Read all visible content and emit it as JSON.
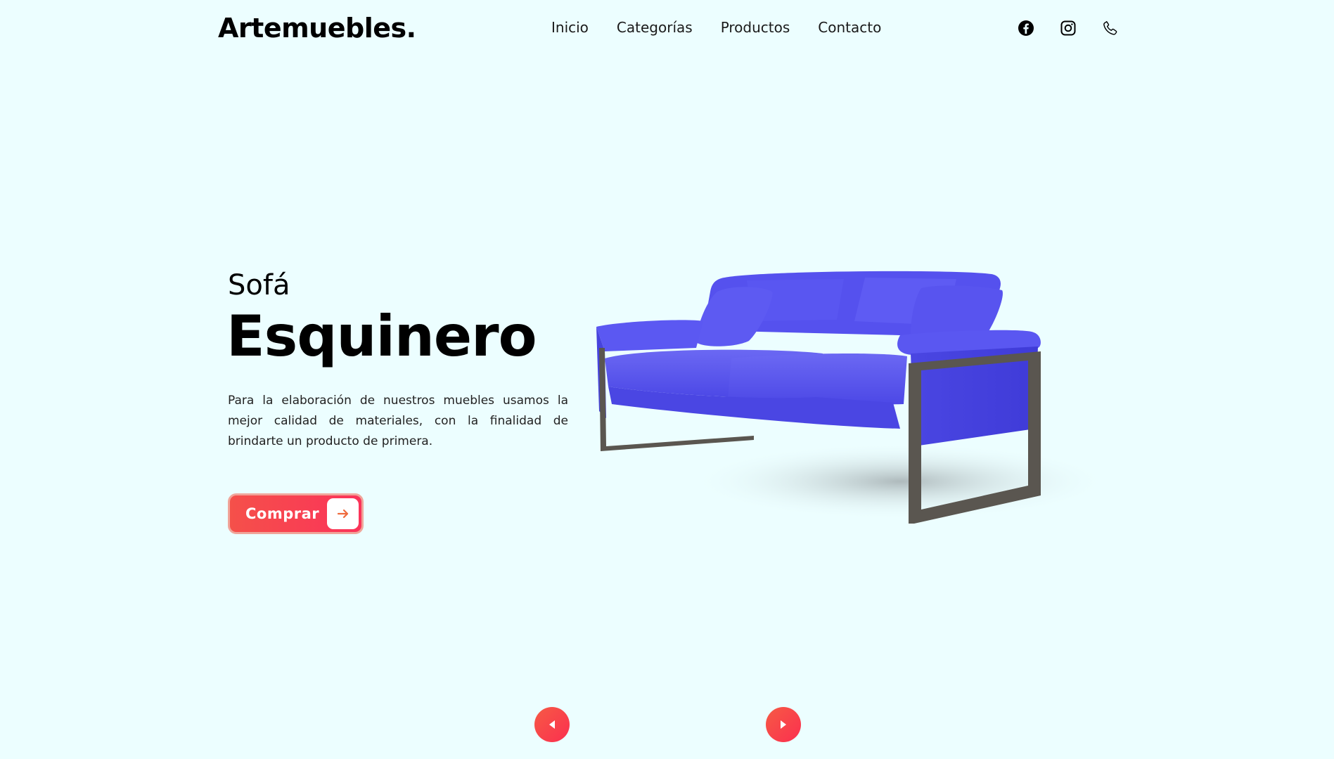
{
  "brand": {
    "logo": "Artemuebles."
  },
  "nav": {
    "items": [
      {
        "label": "Inicio"
      },
      {
        "label": "Categorías"
      },
      {
        "label": "Productos"
      },
      {
        "label": "Contacto"
      }
    ]
  },
  "social": {
    "icons": [
      "facebook-icon",
      "instagram-icon",
      "phone-icon"
    ]
  },
  "hero": {
    "subtitle": "Sofá",
    "title": "Esquinero",
    "description": "Para la elaboración de nuestros muebles usamos la mejor calidad de materiales, con la finalidad de brindarte un producto de primera.",
    "cta_label": "Comprar"
  },
  "colors": {
    "background": "#ecfeff",
    "accent_start": "#f5504a",
    "accent_end": "#fb3359",
    "sofa": "#5450ec"
  }
}
